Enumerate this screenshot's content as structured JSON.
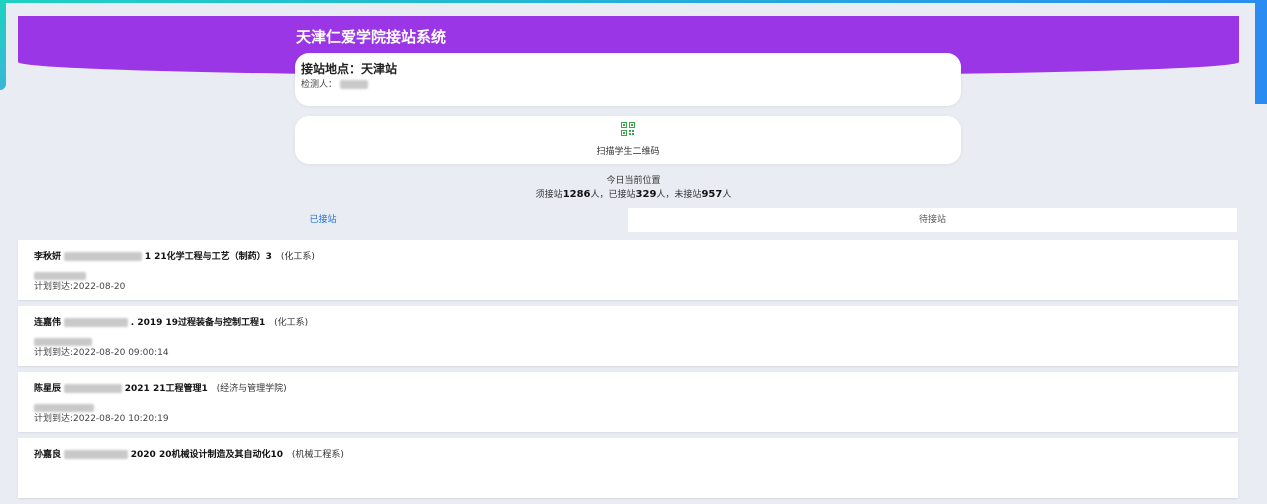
{
  "header": {
    "title": "天津仁爱学院接站系统"
  },
  "station": {
    "label": "接站地点：天津站",
    "checker_label": "检测人："
  },
  "scan": {
    "label": "扫描学生二维码",
    "icon": "qrcode-icon"
  },
  "stats": {
    "title": "今日当前位置",
    "need_prefix": "须接站",
    "need_count": "1286",
    "picked_prefix": "人，已接站",
    "picked_count": "329",
    "pending_prefix": "人，未接站",
    "pending_count": "957",
    "suffix": "人"
  },
  "tabs": [
    {
      "label": "已接站"
    },
    {
      "label": "待接站"
    }
  ],
  "students": [
    {
      "name": "李秋妍",
      "class": "1 21化学工程与工艺（制药）3",
      "dept": "(化工系)",
      "plan": "计划到达:2022-08-20"
    },
    {
      "name": "连嘉伟",
      "class": ". 2019 19过程装备与控制工程1",
      "dept": "(化工系)",
      "plan": "计划到达:2022-08-20 09:00:14"
    },
    {
      "name": "陈星辰",
      "class": "2021 21工程管理1",
      "dept": "(经济与管理学院)",
      "plan": "计划到达:2022-08-20 10:20:19"
    },
    {
      "name": "孙嘉良",
      "class": "2020 20机械设计制造及其自动化10",
      "dept": "(机械工程系)",
      "plan": ""
    }
  ],
  "colors": {
    "header": "#9b36e6",
    "accent_left": "#1fd1c1",
    "accent_right": "#2a8cf0",
    "icon_green": "#3aa84a",
    "tab_active_text": "#1f6fd1"
  }
}
